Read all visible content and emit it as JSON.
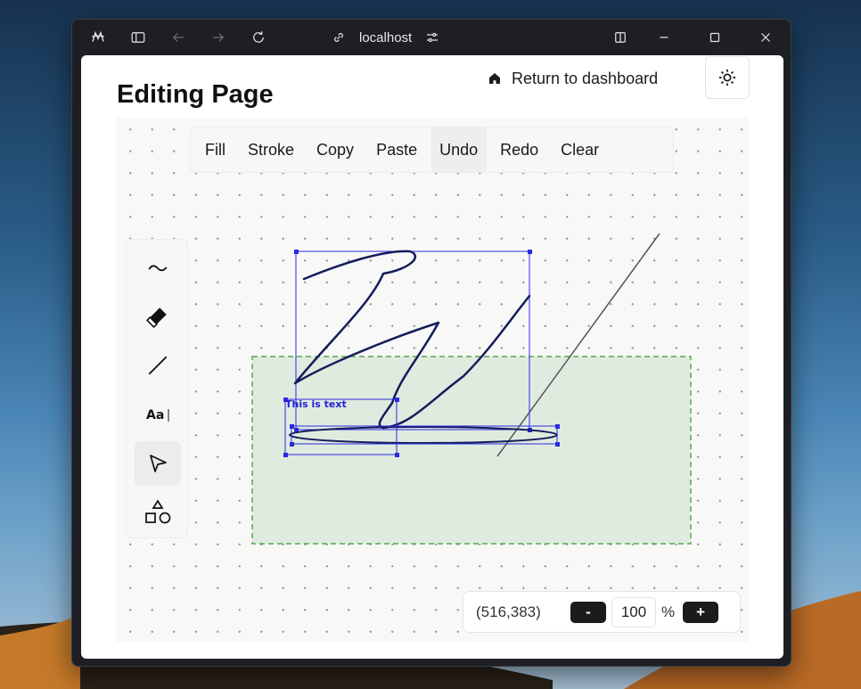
{
  "browser": {
    "address": "localhost"
  },
  "page": {
    "title": "Editing Page",
    "return_label": "Return to dashboard"
  },
  "toolbar": {
    "buttons": [
      "Fill",
      "Stroke",
      "Copy",
      "Paste",
      "Undo",
      "Redo",
      "Clear"
    ],
    "active": "Undo"
  },
  "tools": {
    "items": [
      "freehand-tool",
      "eraser-tool",
      "line-tool",
      "text-tool",
      "select-tool",
      "shapes-tool"
    ],
    "active": "select-tool"
  },
  "canvas": {
    "text_object": "This is text",
    "selection_color": "#1f1fd6",
    "stroke_color": "#141c5c",
    "area_fill_color": "#e0ebdf",
    "area_border_color": "#55a84f"
  },
  "zoom": {
    "coordinates": "(516,383)",
    "value": "100",
    "unit": "%",
    "minus_label": "-",
    "plus_label": "+"
  }
}
